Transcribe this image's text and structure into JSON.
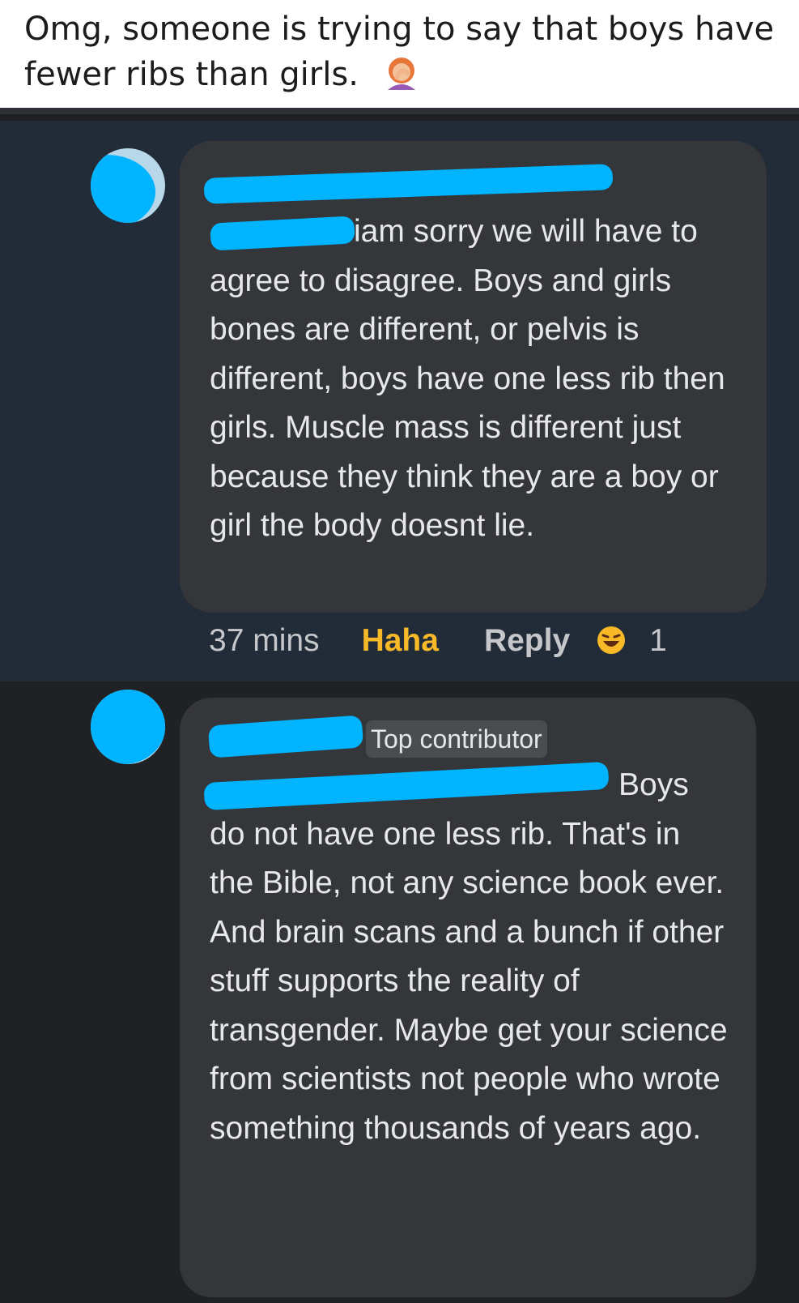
{
  "caption": {
    "text": "Omg, someone is trying to say that boys have fewer ribs than girls.",
    "emoji": "woman-facepalming"
  },
  "comments": [
    {
      "text_visible": "iam sorry we will have to agree to disagree. Boys and girls bones are different, or pelvis is different, boys have one less rib then girls. Muscle mass is different just because they think they are a boy or girl the body doesnt lie.",
      "time": "37 mins",
      "reaction_label": "Haha",
      "reply_label": "Reply",
      "reaction_icon": "haha-emoji",
      "reaction_count": "1"
    },
    {
      "badge": "Top contributor",
      "text_visible": "Boys do not have one less rib.  That's in the Bible, not any science book ever.  And brain scans and a bunch if other stuff supports the reality of transgender.  Maybe get your science from scientists not people who wrote something thousands of years ago."
    }
  ],
  "colors": {
    "redaction": "#00b4ff",
    "haha": "#f7b928",
    "bubble": "#34363a",
    "highlight_bg": "#222b38",
    "dark_bg": "#202124"
  }
}
